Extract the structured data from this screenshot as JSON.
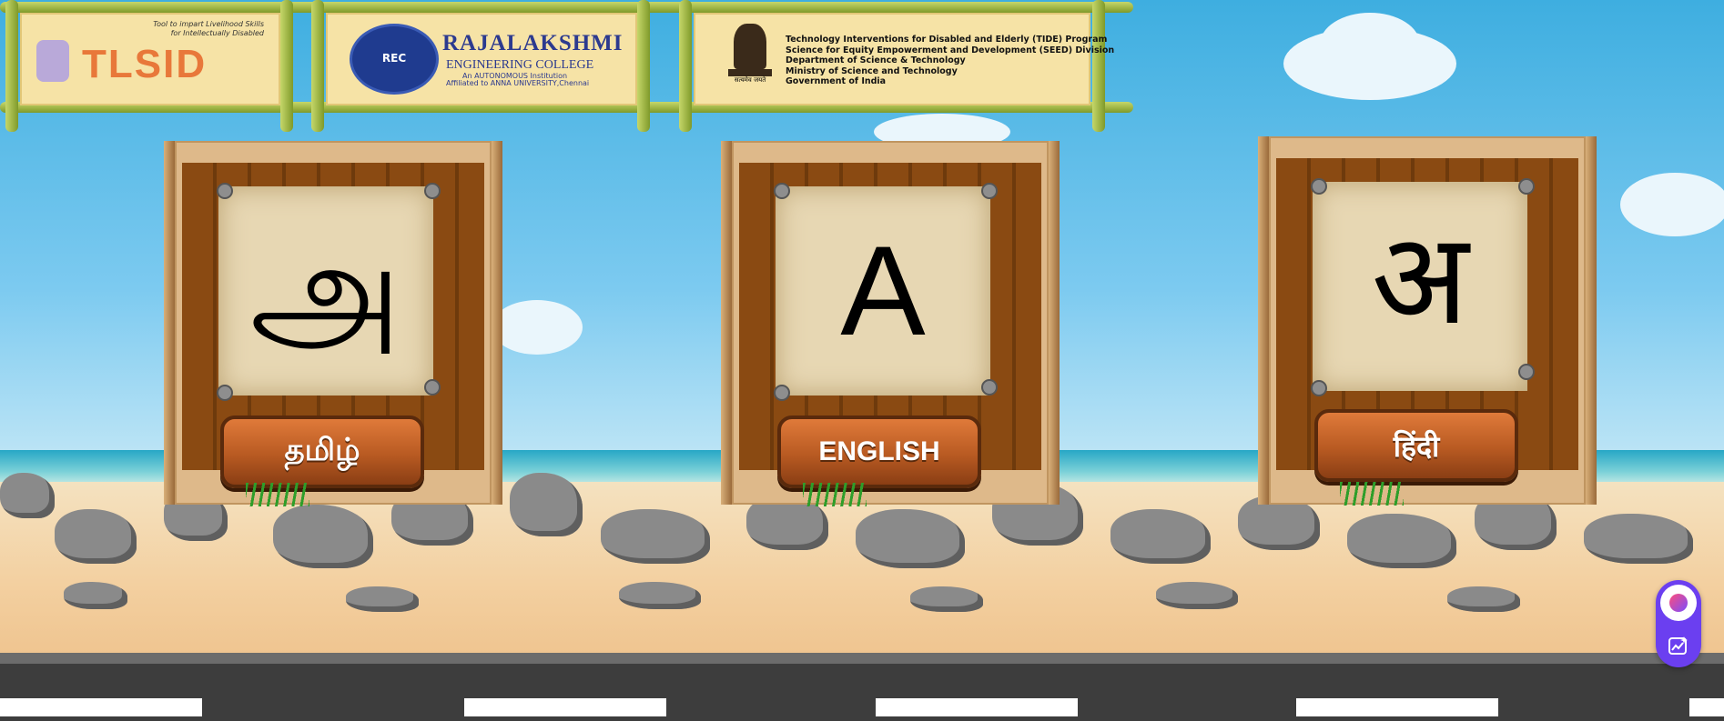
{
  "header": {
    "tlsid": {
      "tagline_1": "Tool to impart Livelihood Skills",
      "tagline_2": "for Intellectually Disabled",
      "name": "TLSID"
    },
    "college": {
      "seal_text": "REC",
      "name": "RAJALAKSHMI",
      "sub": "ENGINEERING COLLEGE",
      "autonomous": "An AUTONOMOUS Institution",
      "affiliation": "Affiliated to ANNA UNIVERSITY,Chennai"
    },
    "government": {
      "motto": "सत्यमेव जयते",
      "lines": [
        "Technology Interventions for Disabled and Elderly (TIDE) Program",
        "Science for Equity Empowerment and Development (SEED) Division",
        "Department of Science & Technology",
        "Ministry of Science and Technology",
        "Government of India"
      ]
    }
  },
  "languages": [
    {
      "letter": "அ",
      "label": "தமிழ்"
    },
    {
      "letter": "A",
      "label": "ENGLISH"
    },
    {
      "letter": "अ",
      "label": "हिंदी"
    }
  ],
  "widget": {
    "top_icon": "assistant-orb-icon",
    "bottom_icon": "sparkle-chart-icon",
    "color": "#6b3ff0"
  }
}
